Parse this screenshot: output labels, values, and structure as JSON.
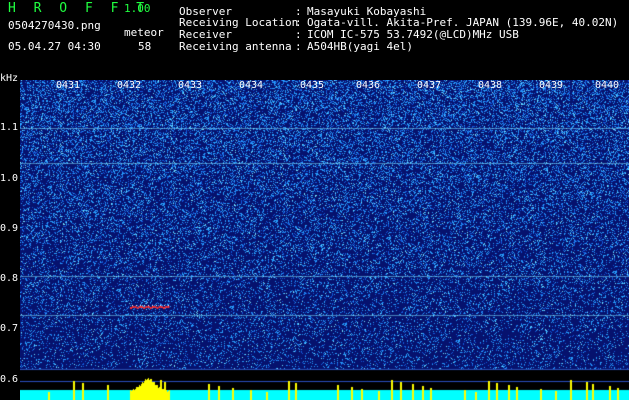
{
  "app": {
    "name": "H R O F F T",
    "version": "1.00"
  },
  "file": {
    "name": "0504270430.png",
    "datetime": "05.04.27 04:30"
  },
  "meteor": {
    "label": "meteor",
    "count": "58"
  },
  "info": [
    {
      "label": "Observer",
      "value": "Masayuki Kobayashi"
    },
    {
      "label": "Receiving Location",
      "value": "Ogata-vill. Akita-Pref. JAPAN (139.96E, 40.02N)"
    },
    {
      "label": "Receiver",
      "value": "ICOM IC-575 53.7492(@LCD)MHz USB"
    },
    {
      "label": "Receiving antenna",
      "value": "A504HB(yagi 4el)"
    }
  ],
  "axis": {
    "unit": "kHz",
    "y_ticks": [
      "1.1",
      "1.0",
      "0.9",
      "0.8",
      "0.7",
      "0.6"
    ],
    "time_ticks": [
      "0431",
      "0432",
      "0433",
      "0434",
      "0435",
      "0436",
      "0437",
      "0438",
      "0439",
      "0440"
    ]
  },
  "colors": {
    "background": "#000000",
    "title": "#20ff40",
    "spectrum_base": "#0a1a80",
    "noise_hi": "#3cc8ff",
    "meteor": "#ffff00",
    "baseline": "#00ffff",
    "trail": "#ff3030"
  }
}
